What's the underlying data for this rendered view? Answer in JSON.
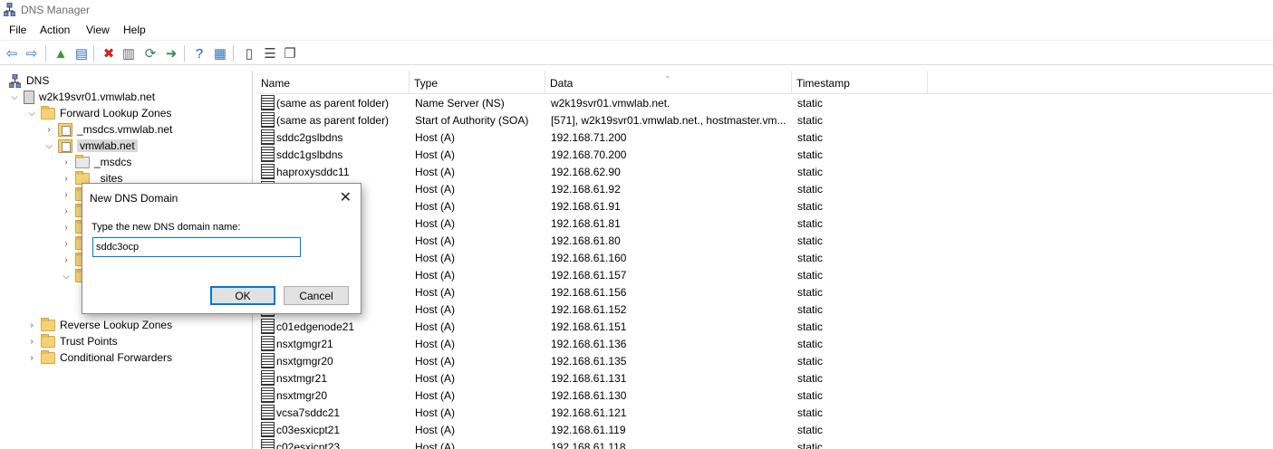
{
  "window": {
    "title": "DNS Manager"
  },
  "menu": [
    {
      "label": "File"
    },
    {
      "label": "Action"
    },
    {
      "label": "View"
    },
    {
      "label": "Help"
    }
  ],
  "toolbar": {
    "buttons": [
      {
        "name": "back-icon",
        "glyph": "⇦",
        "color": "#1f6fd1"
      },
      {
        "name": "forward-icon",
        "glyph": "⇨",
        "color": "#1f6fd1"
      },
      {
        "name": "up-folder-icon",
        "glyph": "▲",
        "color": "#3a9a3a"
      },
      {
        "name": "show-hide-tree-icon",
        "glyph": "▤",
        "color": "#3a70b8"
      },
      {
        "name": "delete-icon",
        "glyph": "✖",
        "color": "#d0231c"
      },
      {
        "name": "properties-icon",
        "glyph": "▥",
        "color": "#666666"
      },
      {
        "name": "refresh-icon",
        "glyph": "⟳",
        "color": "#2e8b57"
      },
      {
        "name": "export-list-icon",
        "glyph": "➜",
        "color": "#2e8b57"
      },
      {
        "name": "help-icon",
        "glyph": "?",
        "color": "#2255aa"
      },
      {
        "name": "action-pane-icon",
        "glyph": "▦",
        "color": "#3a70b8"
      },
      {
        "name": "record-icon",
        "glyph": "▯",
        "color": "#444444"
      },
      {
        "name": "list-icon",
        "glyph": "☰",
        "color": "#444444"
      },
      {
        "name": "copy-icon",
        "glyph": "❐",
        "color": "#444444"
      }
    ]
  },
  "tree": {
    "items": [
      {
        "label": "DNS",
        "icon": "dns-root-icon"
      },
      {
        "label": "w2k19svr01.vmwlab.net",
        "icon": "server-icon"
      },
      {
        "label": "Forward Lookup Zones",
        "icon": "folder-icon"
      },
      {
        "label": "_msdcs.vmwlab.net",
        "icon": "zone-icon"
      },
      {
        "label": "vmwlab.net",
        "icon": "zone-icon"
      },
      {
        "label": "_msdcs",
        "icon": "folder-icon"
      },
      {
        "label": "_sites",
        "icon": "folder-icon"
      },
      {
        "label": "Reverse Lookup Zones",
        "icon": "folder-icon"
      },
      {
        "label": "Trust Points",
        "icon": "folder-icon"
      },
      {
        "label": "Conditional Forwarders",
        "icon": "folder-icon"
      }
    ]
  },
  "grid": {
    "columns": [
      "Name",
      "Type",
      "Data",
      "Timestamp"
    ],
    "rows": [
      {
        "name": "(same as parent folder)",
        "type": "Name Server (NS)",
        "data": "w2k19svr01.vmwlab.net.",
        "ts": "static"
      },
      {
        "name": "(same as parent folder)",
        "type": "Start of Authority (SOA)",
        "data": "[571], w2k19svr01.vmwlab.net., hostmaster.vm...",
        "ts": "static"
      },
      {
        "name": "sddc2gslbdns",
        "type": "Host (A)",
        "data": "192.168.71.200",
        "ts": "static"
      },
      {
        "name": "sddc1gslbdns",
        "type": "Host (A)",
        "data": "192.168.70.200",
        "ts": "static"
      },
      {
        "name": "haproxysddc11",
        "type": "Host (A)",
        "data": "192.168.62.90",
        "ts": "static"
      },
      {
        "name": "",
        "type": "Host (A)",
        "data": "192.168.61.92",
        "ts": "static"
      },
      {
        "name": "",
        "type": "Host (A)",
        "data": "192.168.61.91",
        "ts": "static"
      },
      {
        "name": "",
        "type": "Host (A)",
        "data": "192.168.61.81",
        "ts": "static"
      },
      {
        "name": "",
        "type": "Host (A)",
        "data": "192.168.61.80",
        "ts": "static"
      },
      {
        "name": "",
        "type": "Host (A)",
        "data": "192.168.61.160",
        "ts": "static"
      },
      {
        "name": "",
        "type": "Host (A)",
        "data": "192.168.61.157",
        "ts": "static"
      },
      {
        "name": "",
        "type": "Host (A)",
        "data": "192.168.61.156",
        "ts": "static"
      },
      {
        "name": "",
        "type": "Host (A)",
        "data": "192.168.61.152",
        "ts": "static"
      },
      {
        "name": "c01edgenode21",
        "type": "Host (A)",
        "data": "192.168.61.151",
        "ts": "static"
      },
      {
        "name": "nsxtgmgr21",
        "type": "Host (A)",
        "data": "192.168.61.136",
        "ts": "static"
      },
      {
        "name": "nsxtgmgr20",
        "type": "Host (A)",
        "data": "192.168.61.135",
        "ts": "static"
      },
      {
        "name": "nsxtmgr21",
        "type": "Host (A)",
        "data": "192.168.61.131",
        "ts": "static"
      },
      {
        "name": "nsxtmgr20",
        "type": "Host (A)",
        "data": "192.168.61.130",
        "ts": "static"
      },
      {
        "name": "vcsa7sddc21",
        "type": "Host (A)",
        "data": "192.168.61.121",
        "ts": "static"
      },
      {
        "name": "c03esxicpt21",
        "type": "Host (A)",
        "data": "192.168.61.119",
        "ts": "static"
      },
      {
        "name": "c02esxicpt23",
        "type": "Host (A)",
        "data": "192.168.61.118",
        "ts": "static"
      }
    ]
  },
  "dialog": {
    "title": "New DNS Domain",
    "prompt": "Type the new DNS domain name:",
    "value": "sddc3ocp",
    "ok_label": "OK",
    "cancel_label": "Cancel"
  }
}
